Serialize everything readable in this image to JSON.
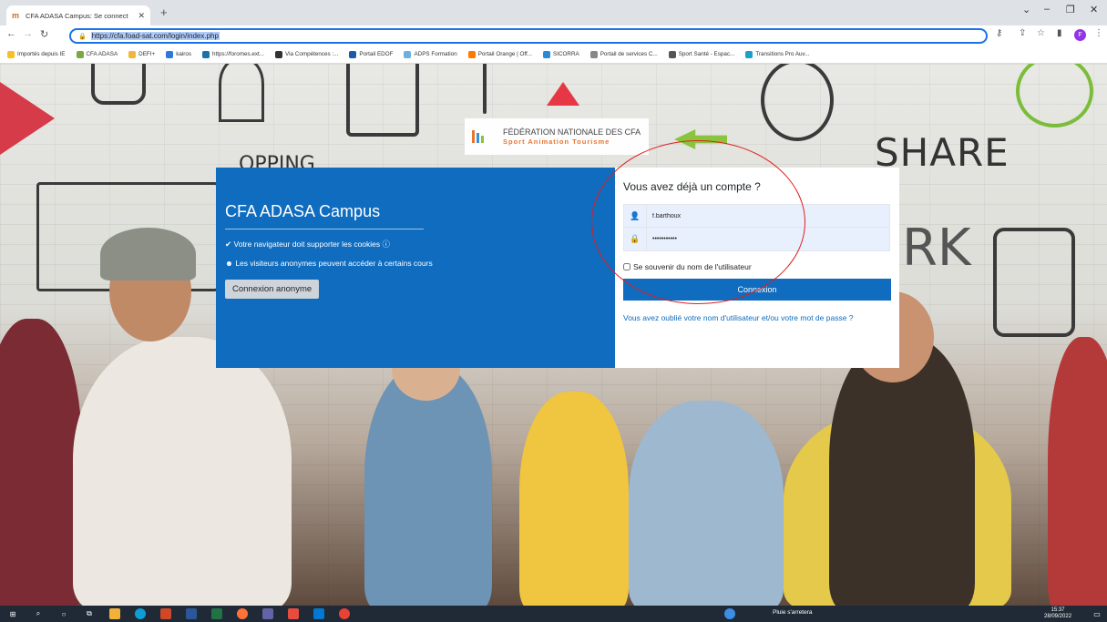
{
  "browser": {
    "tab_title": "CFA ADASA Campus: Se connect",
    "tab_close": "✕",
    "new_tab": "+",
    "url": "https://cfa.foad-sat.com/login/index.php",
    "profile_initial": "F",
    "bookmarks": [
      {
        "label": "Importés depuis IE",
        "color": "#f6c026"
      },
      {
        "label": "CFA ADASA",
        "color": "#7aa843"
      },
      {
        "label": "DEFI+",
        "color": "#f2b73a"
      },
      {
        "label": "kairos",
        "color": "#2c7ad6"
      },
      {
        "label": "https://foromes.ext...",
        "color": "#1a73a8"
      },
      {
        "label": "Via Compétences :...",
        "color": "#333333"
      },
      {
        "label": "Portail EDOF",
        "color": "#1c5aa8"
      },
      {
        "label": "ADPS Formation",
        "color": "#6ab0e0"
      },
      {
        "label": "Portail Orange | Off...",
        "color": "#ff7900"
      },
      {
        "label": "SICORRA",
        "color": "#2b8ad8"
      },
      {
        "label": "Portail de services C...",
        "color": "#888888"
      },
      {
        "label": "Sport Santé - Espac...",
        "color": "#555555"
      },
      {
        "label": "Transitions Pro Auv...",
        "color": "#1ba0c8"
      }
    ]
  },
  "background": {
    "share_word": "SHARE",
    "shopping_word": "OPPING",
    "rk_word": "RK"
  },
  "logo": {
    "title": "FÉDÉRATION NATIONALE DES CFA",
    "subtitle": "Sport Animation Tourisme"
  },
  "login": {
    "site_name": "CFA ADASA Campus",
    "cookies_notice": "Votre navigateur doit supporter les cookies",
    "guest_notice": "Les visiteurs anonymes peuvent accéder à certains cours",
    "guest_button": "Connexion anonyme",
    "title": "Vous avez déjà un compte ?",
    "username_value": "f.barthoux",
    "password_value": "•••••••••••",
    "remember_label": "Se souvenir du nom de l'utilisateur",
    "login_button": "Connexion",
    "forgot_link": "Vous avez oublié votre nom d'utilisateur et/ou votre mot de passe ?"
  },
  "taskbar": {
    "weather": "Pluie s'arretera",
    "time": "15:37",
    "date": "28/09/2022"
  },
  "colors": {
    "brand_blue": "#0f6cbf",
    "annotation_red": "#e21d1d",
    "logo_orange": "#e8752f"
  }
}
